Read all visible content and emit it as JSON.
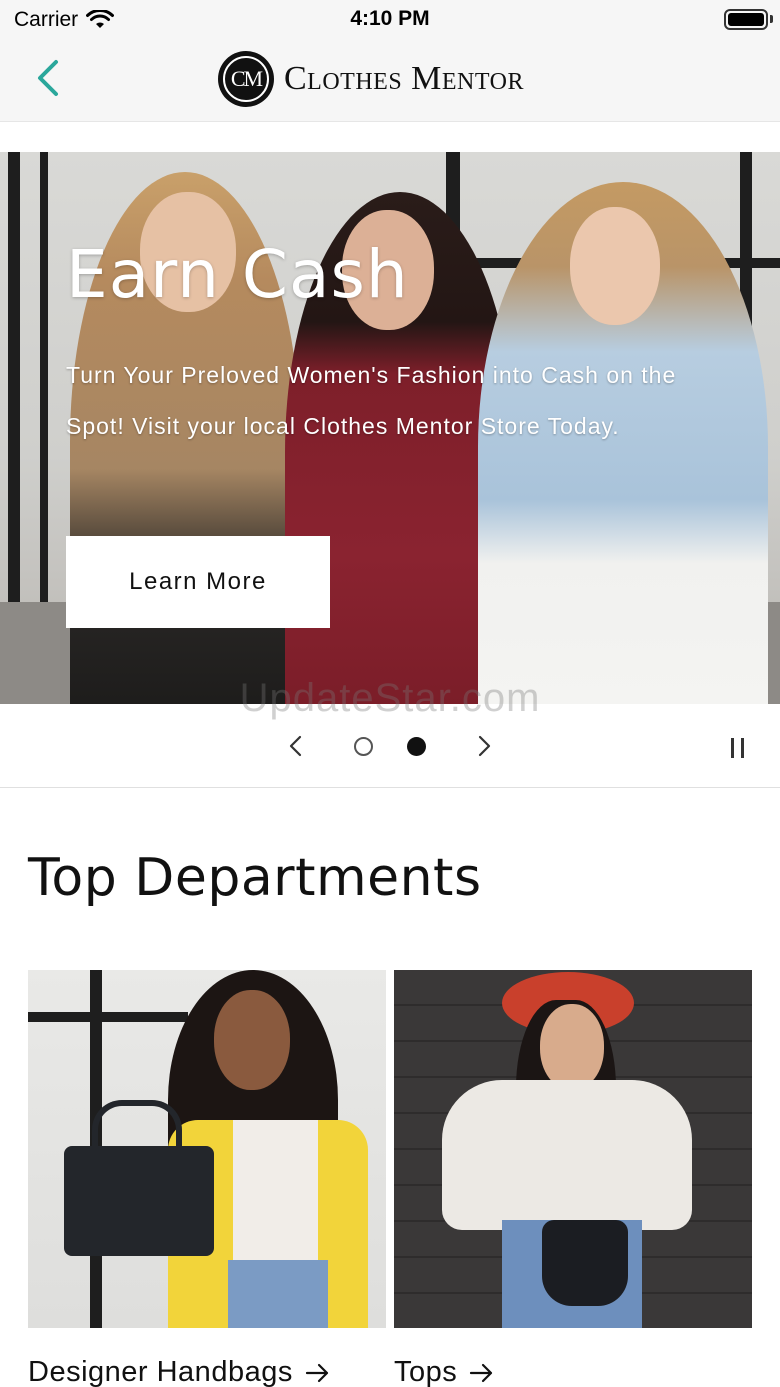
{
  "status_bar": {
    "carrier": "Carrier",
    "time": "4:10 PM"
  },
  "nav": {
    "back_icon": "chevron-left-icon",
    "brand_mark": "CM",
    "brand_name": "Clothes Mentor",
    "accent_color": "#2aa79b"
  },
  "hero": {
    "title": "Earn Cash",
    "subtitle": "Turn Your Preloved Women's Fashion into Cash on the Spot! Visit your local Clothes Mentor Store Today.",
    "cta_label": "Learn More"
  },
  "carousel": {
    "watermark": "UpdateStar.com",
    "slides_total": 2,
    "active_slide": 2,
    "prev_icon": "chevron-left-icon",
    "next_icon": "chevron-right-icon",
    "pause_icon": "pause-icon"
  },
  "departments": {
    "title": "Top Departments",
    "items": [
      {
        "label": "Designer Handbags",
        "arrow_icon": "arrow-right-icon"
      },
      {
        "label": "Tops",
        "arrow_icon": "arrow-right-icon"
      }
    ]
  }
}
